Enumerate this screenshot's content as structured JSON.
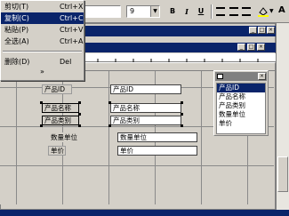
{
  "toolbar": {
    "font_size": "9",
    "bold": "B",
    "italic": "I",
    "underline": "U"
  },
  "edit_menu": {
    "items": [
      {
        "label": "剪切(T)",
        "shortcut": "Ctrl+X"
      },
      {
        "label": "复制(C)",
        "shortcut": "Ctrl+C"
      },
      {
        "label": "粘贴(P)",
        "shortcut": "Ctrl+V"
      },
      {
        "label": "全选(A)",
        "shortcut": "Ctrl+A"
      },
      {
        "label": "删除(D)",
        "shortcut": "Del"
      }
    ],
    "more": "»"
  },
  "form": {
    "labels": [
      "产品ID",
      "产品名称",
      "产品类别",
      "数量单位",
      "单价"
    ],
    "fields": [
      "产品ID",
      "产品名称",
      "产品类别",
      "数量单位",
      "单价"
    ]
  },
  "field_list": {
    "items": [
      "产品ID",
      "产品名称",
      "产品类别",
      "数量单位",
      "单价"
    ]
  },
  "colors": {
    "selection": "#0a246a",
    "title_blue": "#0a246a"
  }
}
